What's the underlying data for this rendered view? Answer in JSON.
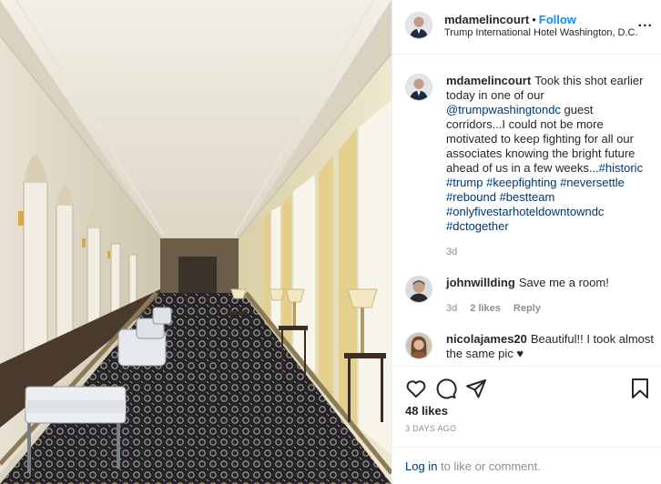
{
  "post": {
    "username": "mdamelincourt",
    "separator": "•",
    "follow_label": "Follow",
    "location": "Trump International Hotel Washington, D.C.",
    "more_label": "...",
    "caption": {
      "username": "mdamelincourt",
      "text_1": "Took this shot earlier today in one of our ",
      "mention": "@trumpwashingtondc",
      "text_2": " guest corridors...I could not be more motivated to keep fighting for all our associates knowing the bright future ahead of us in a few weeks...",
      "hashtags": [
        "#historic",
        "#trump",
        "#keepfighting",
        "#neversettle",
        "#rebound",
        "#bestteam",
        "#onlyfivestarhoteldowntowndc",
        "#dctogether"
      ],
      "age": "3d"
    },
    "comments": [
      {
        "username": "johnwillding",
        "text": "Save me a room!",
        "age": "3d",
        "likes": "2 likes",
        "reply_label": "Reply"
      },
      {
        "username": "nicolajames20",
        "text": "Beautiful!! I took almost the same pic ♥"
      }
    ],
    "likes_count": "48 likes",
    "posted_ago": "3 DAYS AGO",
    "login_link": "Log in",
    "login_suffix": " to like or comment."
  },
  "icons": {
    "like": "heart-icon",
    "comment": "comment-icon",
    "share": "paper-plane-icon",
    "save": "bookmark-icon"
  },
  "colors": {
    "link_blue": "#0095f6",
    "tag_blue": "#00376b",
    "muted": "#8e8e8e",
    "text": "#262626"
  }
}
